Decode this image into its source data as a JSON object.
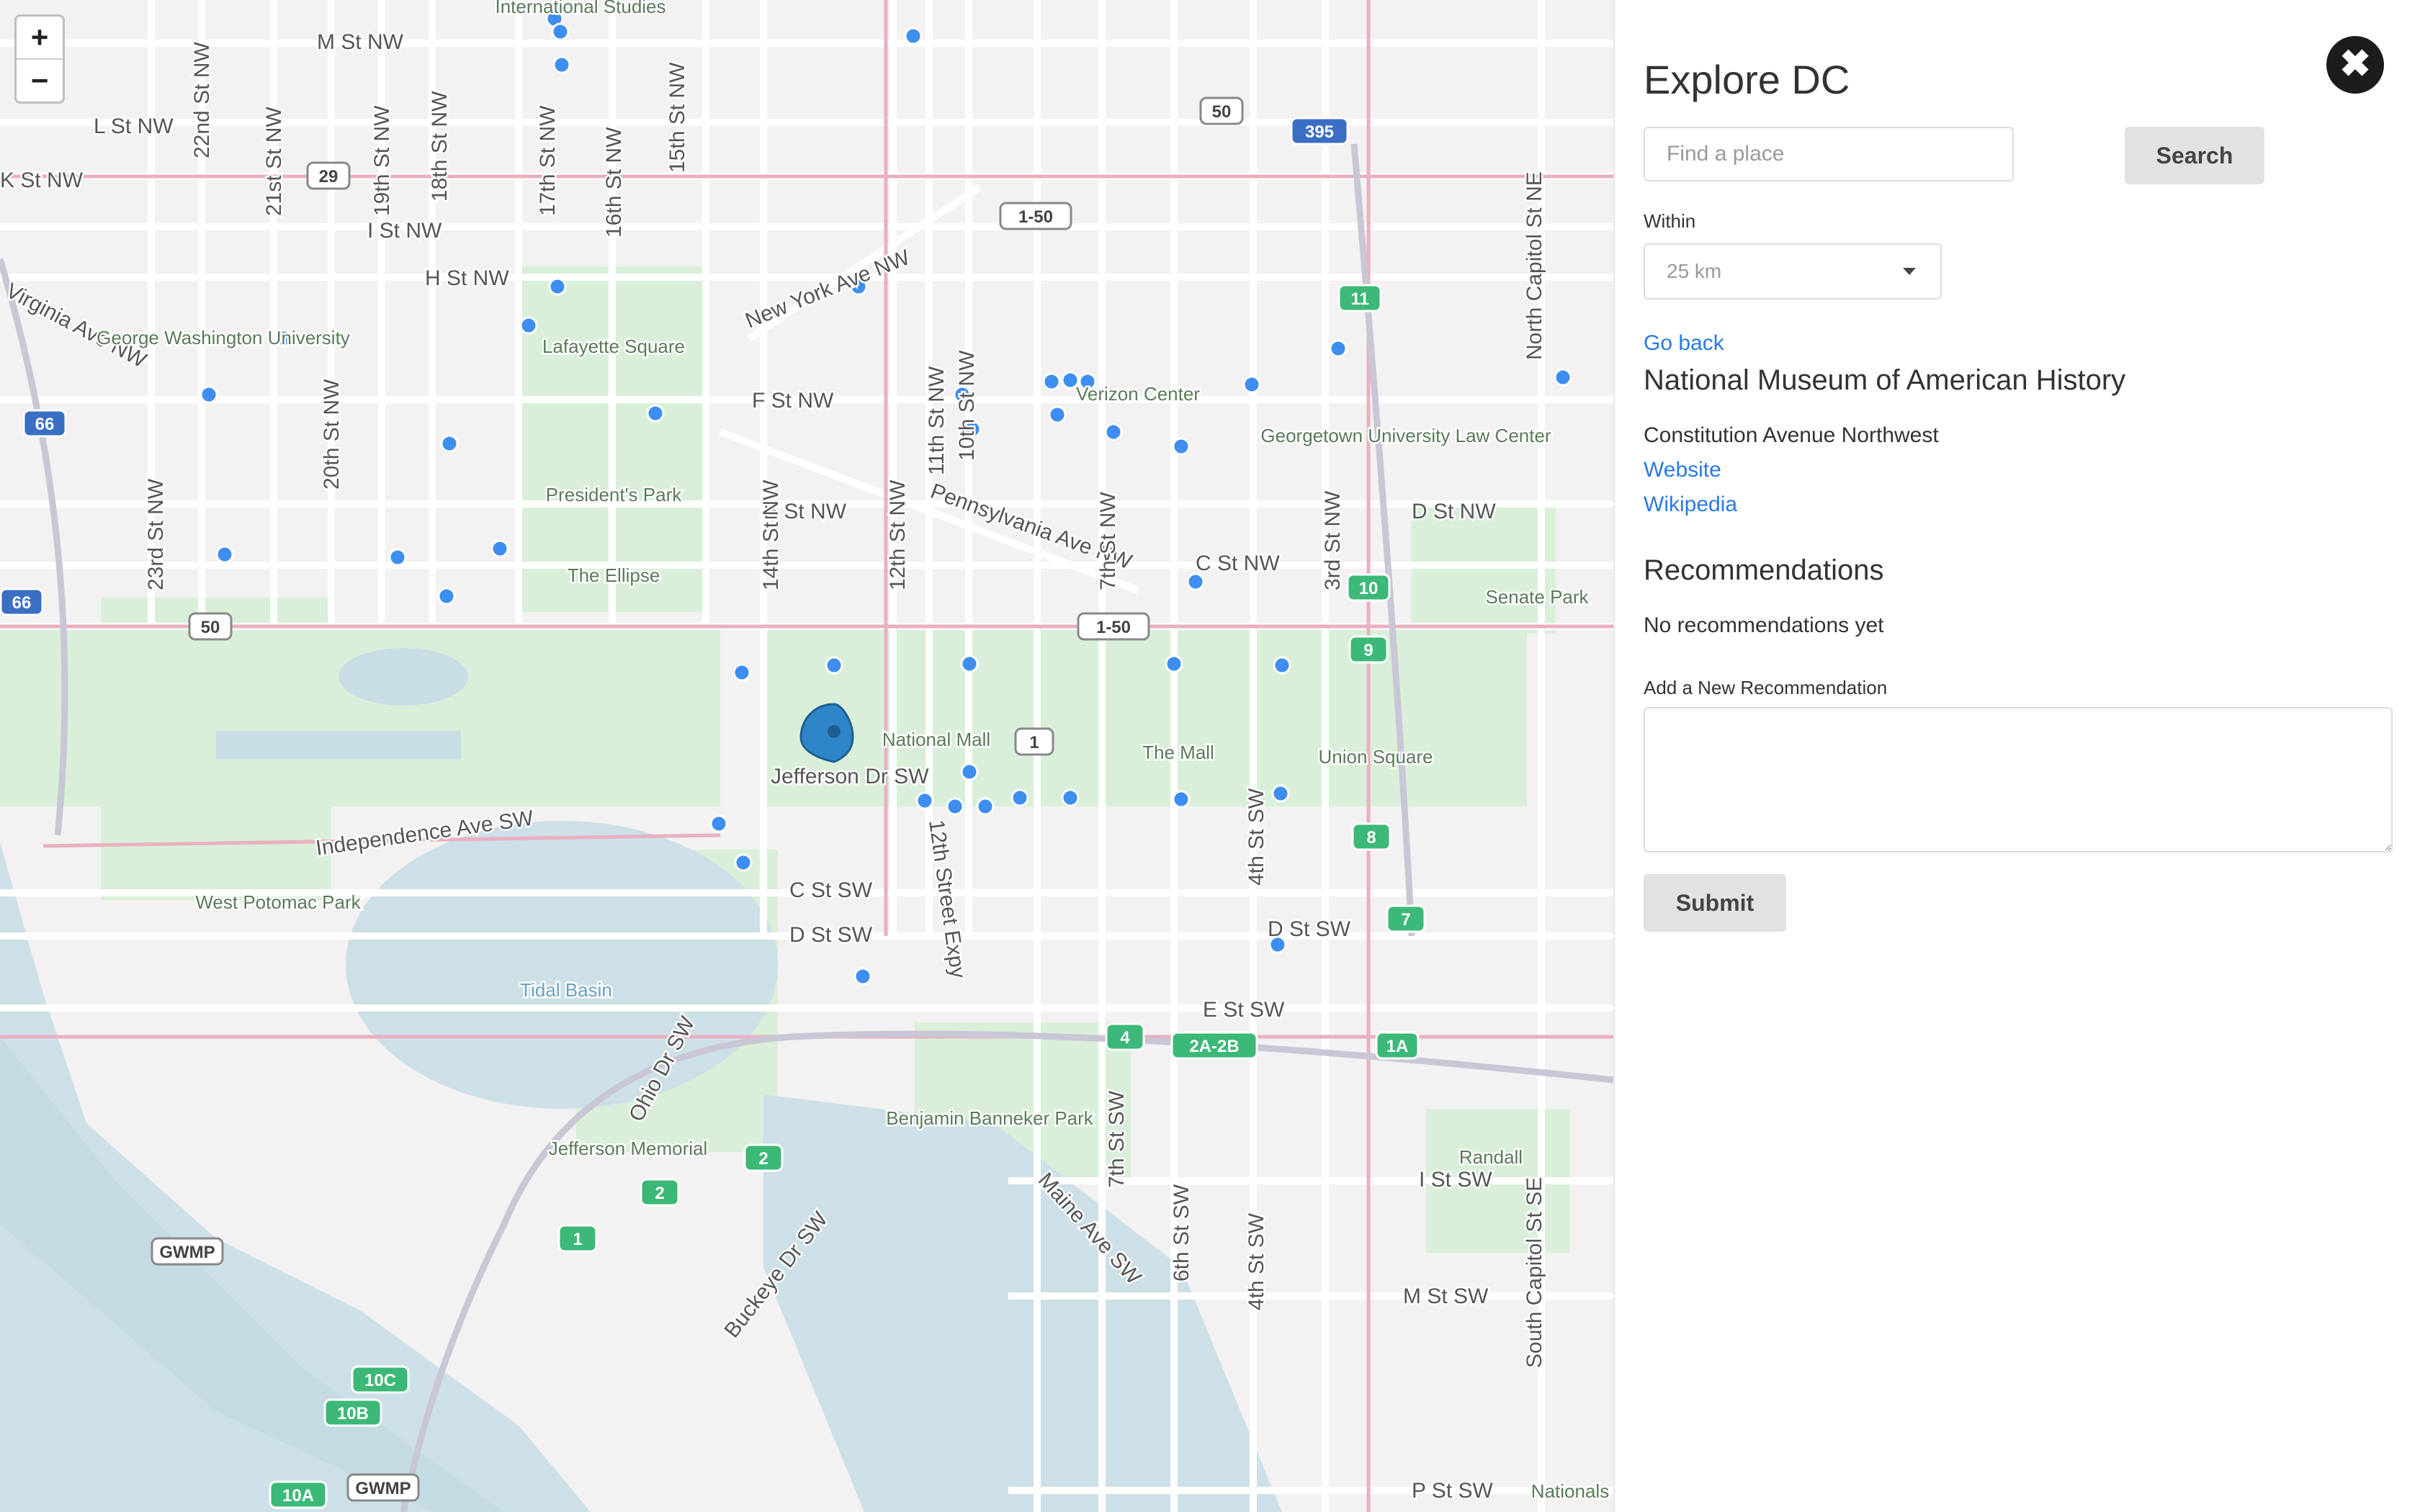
{
  "map": {
    "zoom_in": "+",
    "zoom_out": "−",
    "street_labels": [
      "M St NW",
      "L St NW",
      "K St NW",
      "I St NW",
      "H St NW",
      "F St NW",
      "E St NW",
      "D St NW",
      "C St NW",
      "Pennsylvania Ave NW",
      "New York Ave NW",
      "Independence Ave SW",
      "Jefferson Dr SW",
      "C St SW",
      "D St SW",
      "E St SW",
      "I St SW",
      "M St SW",
      "P St SW",
      "Maine Ave SW",
      "Ohio Dr SW",
      "Buckeye Dr SW",
      "12th Street Expy",
      "Virginia Ave NW",
      "North Capitol St NE",
      "South Capitol St SE",
      "22nd St NW",
      "21st St NW",
      "20th St NW",
      "19th St NW",
      "18th St NW",
      "17th St NW",
      "16th St NW",
      "15th St NW",
      "14th St NW",
      "12th St NW",
      "11th St NW",
      "10th St NW",
      "7th St NW",
      "3rd St NW",
      "23rd St NW",
      "4th St SW",
      "7th St SW",
      "6th St SW",
      "4th St SW",
      "D St SW"
    ],
    "place_labels": [
      "International Studies",
      "George Washington University",
      "Lafayette Square",
      "President's Park",
      "The Ellipse",
      "Verizon Center",
      "Georgetown University Law Center",
      "Senate Park",
      "National Mall",
      "The Mall",
      "Union Square",
      "West Potomac Park",
      "Tidal Basin",
      "Jefferson Memorial",
      "Benjamin Banneker Park",
      "Randall",
      "Nationals"
    ],
    "shields": [
      "29",
      "50",
      "1-50",
      "395",
      "66",
      "66",
      "50",
      "1-50",
      "1",
      "11",
      "10",
      "9",
      "8",
      "7",
      "4",
      "2A-2B",
      "1A",
      "2",
      "2",
      "1",
      "10C",
      "10B",
      "10A",
      "GWMP",
      "GWMP"
    ]
  },
  "panel": {
    "title": "Explore DC",
    "search_placeholder": "Find a place",
    "search_button": "Search",
    "within_label": "Within",
    "within_value": "25 km",
    "go_back": "Go back",
    "place_name": "National Museum of American History",
    "address": "Constitution Avenue Northwest",
    "website_link": "Website",
    "wikipedia_link": "Wikipedia",
    "recommendations_heading": "Recommendations",
    "no_recommendations": "No recommendations yet",
    "add_label": "Add a New Recommendation",
    "submit_button": "Submit",
    "close": "✖"
  },
  "colors": {
    "marker_blue": "#3d8ef0",
    "link_blue": "#2a7ae2",
    "park_green": "#d7efd7",
    "water_blue": "#cfe2e8",
    "shield_green": "#3cb878"
  }
}
